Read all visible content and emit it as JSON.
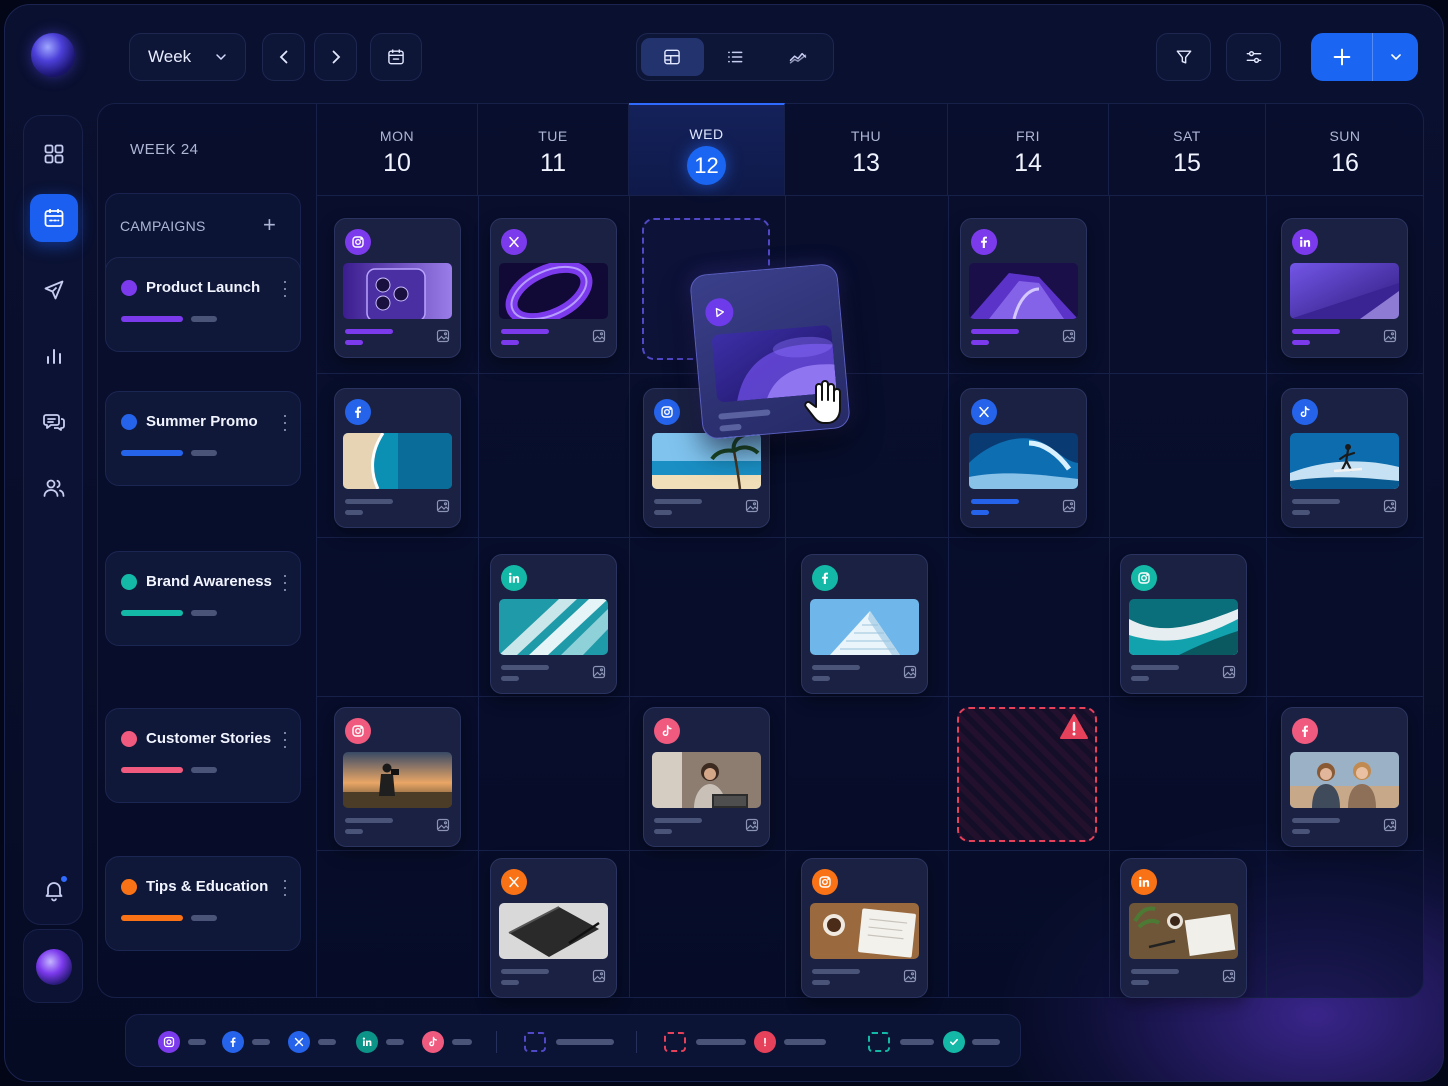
{
  "toolbar": {
    "view_select": "Week",
    "views": [
      "calendar-grid",
      "list",
      "analytics"
    ],
    "active_view": "calendar-grid"
  },
  "sidebar": {
    "items": [
      "dashboard",
      "calendar",
      "publish",
      "analytics",
      "messages",
      "team"
    ],
    "active": "calendar",
    "notifications_unread": true
  },
  "calendar": {
    "week_label": "WEEK 24",
    "days": [
      {
        "name": "MON",
        "num": "10"
      },
      {
        "name": "TUE",
        "num": "11"
      },
      {
        "name": "WED",
        "num": "12",
        "today": true
      },
      {
        "name": "THU",
        "num": "13"
      },
      {
        "name": "FRI",
        "num": "14"
      },
      {
        "name": "SAT",
        "num": "15"
      },
      {
        "name": "SUN",
        "num": "16"
      }
    ]
  },
  "campaigns": {
    "title": "CAMPAIGNS",
    "add_label": "+",
    "items": [
      {
        "name": "Product Launch",
        "color": "#7c3aed"
      },
      {
        "name": "Summer Promo",
        "color": "#2563eb"
      },
      {
        "name": "Brand Awareness",
        "color": "#14b8a6"
      },
      {
        "name": "Customer Stories",
        "color": "#f05a7e"
      },
      {
        "name": "Tips & Education",
        "color": "#f97316"
      }
    ]
  },
  "posts": [
    {
      "campaign": "Product Launch",
      "day": "MON",
      "platform": "instagram",
      "image": "phone"
    },
    {
      "campaign": "Product Launch",
      "day": "TUE",
      "platform": "x",
      "image": "ring"
    },
    {
      "campaign": "Product Launch",
      "day": "FRI",
      "platform": "facebook",
      "image": "car"
    },
    {
      "campaign": "Product Launch",
      "day": "SUN",
      "platform": "linkedin",
      "image": "abstract"
    },
    {
      "campaign": "Summer Promo",
      "day": "MON",
      "platform": "facebook",
      "image": "beach-aerial"
    },
    {
      "campaign": "Summer Promo",
      "day": "WED",
      "platform": "instagram",
      "image": "palm-beach"
    },
    {
      "campaign": "Summer Promo",
      "day": "FRI",
      "platform": "x",
      "image": "wave"
    },
    {
      "campaign": "Summer Promo",
      "day": "SUN",
      "platform": "tiktok",
      "image": "surfer"
    },
    {
      "campaign": "Brand Awareness",
      "day": "TUE",
      "platform": "linkedin",
      "image": "architecture"
    },
    {
      "campaign": "Brand Awareness",
      "day": "THU",
      "platform": "facebook",
      "image": "building"
    },
    {
      "campaign": "Brand Awareness",
      "day": "SAT",
      "platform": "instagram",
      "image": "teal-wave"
    },
    {
      "campaign": "Customer Stories",
      "day": "MON",
      "platform": "instagram",
      "image": "photographer"
    },
    {
      "campaign": "Customer Stories",
      "day": "WED",
      "platform": "tiktok",
      "image": "woman-laptop"
    },
    {
      "campaign": "Customer Stories",
      "day": "FRI",
      "platform": "none",
      "image": "conflict",
      "status": "error"
    },
    {
      "campaign": "Customer Stories",
      "day": "SUN",
      "platform": "facebook",
      "image": "two-women"
    },
    {
      "campaign": "Tips & Education",
      "day": "TUE",
      "platform": "x",
      "image": "notebook"
    },
    {
      "campaign": "Tips & Education",
      "day": "THU",
      "platform": "instagram",
      "image": "coffee-notes"
    },
    {
      "campaign": "Tips & Education",
      "day": "SAT",
      "platform": "linkedin",
      "image": "desk"
    }
  ],
  "drag": {
    "platform": "video",
    "from_day": "WED",
    "campaign": "Product Launch"
  },
  "legend": {
    "platforms": [
      "instagram",
      "facebook",
      "x",
      "linkedin",
      "tiktok"
    ],
    "states": [
      "draft",
      "error",
      "published"
    ]
  },
  "colors": {
    "accent": "#1a66f2",
    "instagram": "#7c3aed",
    "facebook": "#2563eb",
    "teal": "#14b8a6",
    "pink": "#f05a7e",
    "orange": "#f97316",
    "error": "#e6415a"
  }
}
